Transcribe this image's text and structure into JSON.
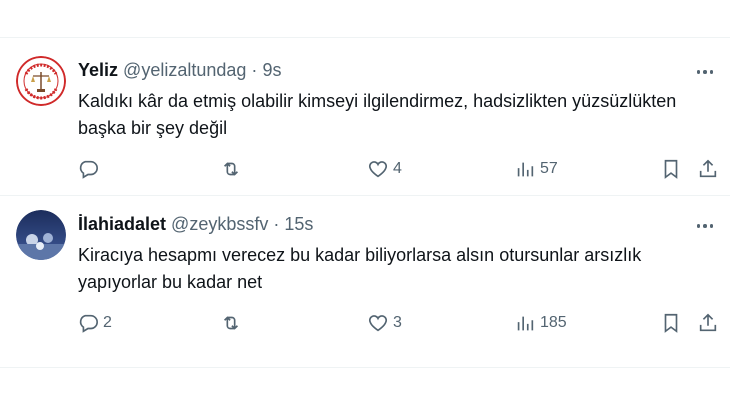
{
  "tweets": [
    {
      "name": "Yeliz",
      "handle": "@yelizaltundag",
      "separator": "·",
      "time": "9s",
      "text": "Kaldıkı kâr da etmiş olabilir kimseyi ilgilendirmez, hadsizlikten yüzsüzlükten başka bir şey değil",
      "reply_count": "",
      "retweet_count": "",
      "like_count": "4",
      "view_count": "57",
      "avatar_logo_text": "ÖZGÜRLÜK ADALET ARTIK"
    },
    {
      "name": "İlahiadalet",
      "handle": "@zeykbssfv",
      "separator": "·",
      "time": "15s",
      "text": "Kiracıya hesapmı verecez bu kadar biliyorlarsa alsın otursunlar arsızlık yapıyorlar bu kadar net",
      "reply_count": "2",
      "retweet_count": "",
      "like_count": "3",
      "view_count": "185"
    }
  ],
  "icons": {
    "reply": "reply-icon",
    "retweet": "retweet-icon",
    "like": "heart-icon",
    "views": "views-icon",
    "bookmark": "bookmark-icon",
    "share": "share-icon",
    "more": "more-icon"
  },
  "colors": {
    "text": "#0f1419",
    "secondary": "#536471",
    "divider": "#eff3f4",
    "logo_red": "#d02a2a"
  }
}
